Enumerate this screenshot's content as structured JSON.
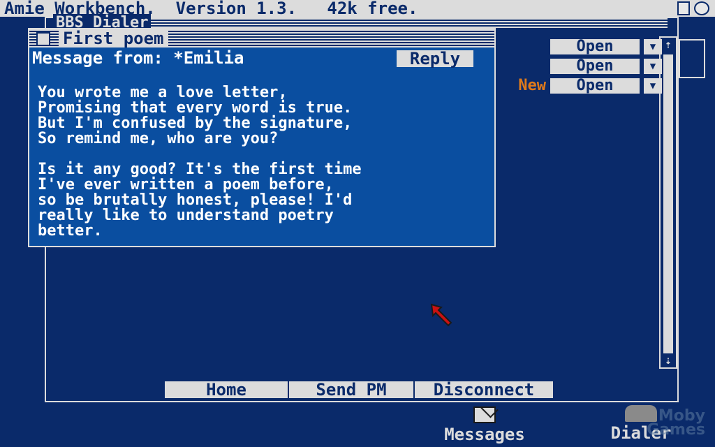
{
  "titlebar": {
    "title": "Amie Workbench.  Version 1.3.   42k free."
  },
  "dialer_window": {
    "title": "BBS Dialer",
    "rows": [
      {
        "status": "",
        "button": "Open",
        "dropdown_icon": "chevron-down-icon"
      },
      {
        "status": "",
        "button": "Open",
        "dropdown_icon": "chevron-down-icon"
      },
      {
        "status": "New",
        "button": "Open",
        "dropdown_icon": "chevron-down-icon"
      }
    ],
    "bottom_buttons": {
      "home": "Home",
      "send_pm": "Send PM",
      "disconnect": "Disconnect"
    },
    "scroll_up": "⇡",
    "scroll_down": "⇣"
  },
  "message_window": {
    "title": "First poem",
    "from_line": "Message from: *Emilia",
    "reply_label": "Reply",
    "body": "You wrote me a love letter,\nPromising that every word is true.\nBut I'm confused by the signature,\nSo remind me, who are you?\n\nIs it any good? It's the first time\nI've ever written a poem before,\nso be brutally honest, please! I'd\nreally like to understand poetry\nbetter."
  },
  "desktop_icons": {
    "messages_label": "Messages",
    "dialer_label": "Dialer"
  },
  "watermark": {
    "line1": "Moby",
    "line2": "Games"
  },
  "colors": {
    "desktop": "#0a2a6a",
    "window": "#0a4ea0",
    "chrome": "#dcdcdc",
    "new_label": "#e07a1a",
    "cursor": "#cc1111"
  }
}
